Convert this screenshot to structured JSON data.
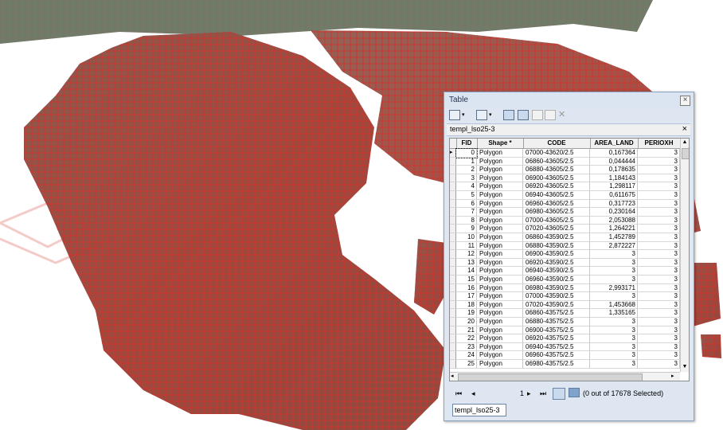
{
  "window": {
    "title": "Table",
    "close_glyph": "×",
    "tab_label": "templ_lso25-3",
    "tab_close": "×",
    "bottom_tab": "templ_lso25-3"
  },
  "columns": [
    "FID",
    "Shape *",
    "CODE",
    "AREA_LAND",
    "PERIOXH"
  ],
  "rows": [
    [
      "0",
      "Polygon",
      "07000-43620/2.5",
      "0,167364",
      "3"
    ],
    [
      "1",
      "Polygon",
      "06860-43605/2.5",
      "0,044444",
      "3"
    ],
    [
      "2",
      "Polygon",
      "06880-43605/2.5",
      "0,178635",
      "3"
    ],
    [
      "3",
      "Polygon",
      "06900-43605/2.5",
      "1,184143",
      "3"
    ],
    [
      "4",
      "Polygon",
      "06920-43605/2.5",
      "1,298117",
      "3"
    ],
    [
      "5",
      "Polygon",
      "06940-43605/2.5",
      "0,611675",
      "3"
    ],
    [
      "6",
      "Polygon",
      "06960-43605/2.5",
      "0,317723",
      "3"
    ],
    [
      "7",
      "Polygon",
      "06980-43605/2.5",
      "0,230164",
      "3"
    ],
    [
      "8",
      "Polygon",
      "07000-43605/2.5",
      "2,053088",
      "3"
    ],
    [
      "9",
      "Polygon",
      "07020-43605/2.5",
      "1,264221",
      "3"
    ],
    [
      "10",
      "Polygon",
      "06860-43590/2.5",
      "1,452789",
      "3"
    ],
    [
      "11",
      "Polygon",
      "06880-43590/2.5",
      "2,872227",
      "3"
    ],
    [
      "12",
      "Polygon",
      "06900-43590/2.5",
      "3",
      "3"
    ],
    [
      "13",
      "Polygon",
      "06920-43590/2.5",
      "3",
      "3"
    ],
    [
      "14",
      "Polygon",
      "06940-43590/2.5",
      "3",
      "3"
    ],
    [
      "15",
      "Polygon",
      "06960-43590/2.5",
      "3",
      "3"
    ],
    [
      "16",
      "Polygon",
      "06980-43590/2.5",
      "2,993171",
      "3"
    ],
    [
      "17",
      "Polygon",
      "07000-43590/2.5",
      "3",
      "3"
    ],
    [
      "18",
      "Polygon",
      "07020-43590/2.5",
      "1,453668",
      "3"
    ],
    [
      "19",
      "Polygon",
      "06860-43575/2.5",
      "1,335165",
      "3"
    ],
    [
      "20",
      "Polygon",
      "06880-43575/2.5",
      "3",
      "3"
    ],
    [
      "21",
      "Polygon",
      "06900-43575/2.5",
      "3",
      "3"
    ],
    [
      "22",
      "Polygon",
      "06920-43575/2.5",
      "3",
      "3"
    ],
    [
      "23",
      "Polygon",
      "06940-43575/2.5",
      "3",
      "3"
    ],
    [
      "24",
      "Polygon",
      "06960-43575/2.5",
      "3",
      "3"
    ],
    [
      "25",
      "Polygon",
      "06980-43575/2.5",
      "3",
      "3"
    ]
  ],
  "navigation": {
    "current_record": "1",
    "selection_status": "(0 out of 17678 Selected)"
  },
  "colors": {
    "grid_red": "#d0342c",
    "land_tint": "#9a4a3e"
  },
  "icons": [
    "table-options-icon",
    "related-tables-icon",
    "select-by-attributes-icon",
    "switch-selection-icon",
    "clear-selection-icon",
    "zoom-to-selected-icon",
    "delete-selected-icon"
  ]
}
